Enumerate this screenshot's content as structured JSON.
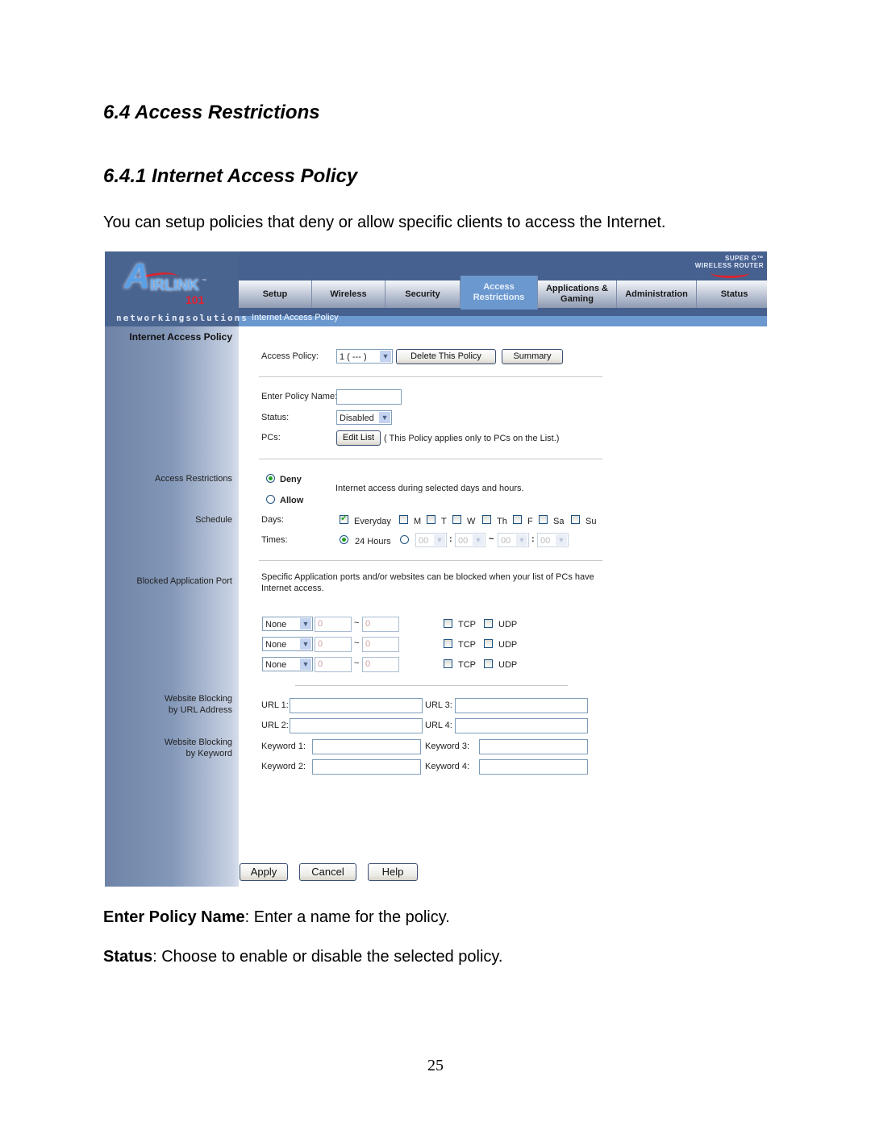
{
  "document": {
    "heading_section": "6.4 Access Restrictions",
    "heading_subsection": "6.4.1 Internet Access Policy",
    "intro": "You can setup policies that deny or allow specific clients to access the Internet.",
    "descriptions": [
      {
        "term": "Enter Policy Name",
        "text": ": Enter a name for the policy."
      },
      {
        "term": "Status",
        "text": ": Choose to enable or disable the selected policy."
      }
    ],
    "page_number": "25"
  },
  "router": {
    "logo": {
      "letter": "A",
      "brand": "IRLINK",
      "suffix": "101",
      "tm": "™",
      "tagline": "networkingsolutions"
    },
    "product_badge": {
      "line1": "SUPER G™",
      "line2": "WIRELESS ROUTER"
    },
    "colors": {
      "header": "#46618f",
      "active_tab": "#6b99cf",
      "check": "#21a121",
      "brand_red": "#d9242f"
    },
    "tabs": [
      {
        "label": "Setup",
        "active": false
      },
      {
        "label": "Wireless",
        "active": false
      },
      {
        "label": "Security",
        "active": false
      },
      {
        "label": "Access Restrictions",
        "active": true
      },
      {
        "label": "Applications & Gaming",
        "active": false
      },
      {
        "label": "Administration",
        "active": false
      },
      {
        "label": "Status",
        "active": false
      }
    ],
    "breadcrumb": "Internet Access Policy",
    "sidebar": {
      "title": "Internet Access Policy",
      "labels": {
        "access_restrictions": "Access Restrictions",
        "schedule": "Schedule",
        "blocked_port": "Blocked Application Port",
        "url_block_1": "Website Blocking",
        "url_block_2": "by URL Address",
        "kw_block_1": "Website Blocking",
        "kw_block_2": "by Keyword"
      }
    },
    "form": {
      "access_policy_label": "Access Policy:",
      "access_policy_value": "1 ( --- )",
      "delete_button": "Delete This Policy",
      "summary_button": "Summary",
      "policy_name_label": "Enter Policy Name:",
      "policy_name_value": "",
      "status_label": "Status:",
      "status_value": "Disabled",
      "pcs_label": "PCs:",
      "edit_list_button": "Edit List",
      "pcs_note": "( This Policy applies only to PCs on the List.)",
      "deny_label": "Deny",
      "allow_label": "Allow",
      "mode_selected": "Deny",
      "mode_description": "Internet access during selected days and hours.",
      "days_label": "Days:",
      "days": [
        {
          "label": "Everyday",
          "checked": true
        },
        {
          "label": "M",
          "checked": false
        },
        {
          "label": "T",
          "checked": false
        },
        {
          "label": "W",
          "checked": false
        },
        {
          "label": "Th",
          "checked": false
        },
        {
          "label": "F",
          "checked": false
        },
        {
          "label": "Sa",
          "checked": false
        },
        {
          "label": "Su",
          "checked": false
        }
      ],
      "times_label": "Times:",
      "times_24h_label": "24 Hours",
      "times_selected": "24 Hours",
      "time_fields": [
        "00",
        "00",
        "00",
        "00"
      ],
      "time_sep_colon": ":",
      "time_sep_tilde": "~",
      "blocked_desc": "Specific Application ports and/or websites can be blocked when your list of PCs have Internet access.",
      "port_rows": [
        {
          "app": "None",
          "start": "0",
          "end": "0",
          "tcp": false,
          "udp": false
        },
        {
          "app": "None",
          "start": "0",
          "end": "0",
          "tcp": false,
          "udp": false
        },
        {
          "app": "None",
          "start": "0",
          "end": "0",
          "tcp": false,
          "udp": false
        }
      ],
      "tcp_label": "TCP",
      "udp_label": "UDP",
      "port_sep": "~",
      "urls": [
        {
          "label": "URL 1:",
          "value": ""
        },
        {
          "label": "URL 2:",
          "value": ""
        },
        {
          "label": "URL 3:",
          "value": ""
        },
        {
          "label": "URL 4:",
          "value": ""
        }
      ],
      "keywords": [
        {
          "label": "Keyword 1:",
          "value": ""
        },
        {
          "label": "Keyword 2:",
          "value": ""
        },
        {
          "label": "Keyword 3:",
          "value": ""
        },
        {
          "label": "Keyword 4:",
          "value": ""
        }
      ]
    },
    "footer_buttons": {
      "apply": "Apply",
      "cancel": "Cancel",
      "help": "Help"
    }
  }
}
